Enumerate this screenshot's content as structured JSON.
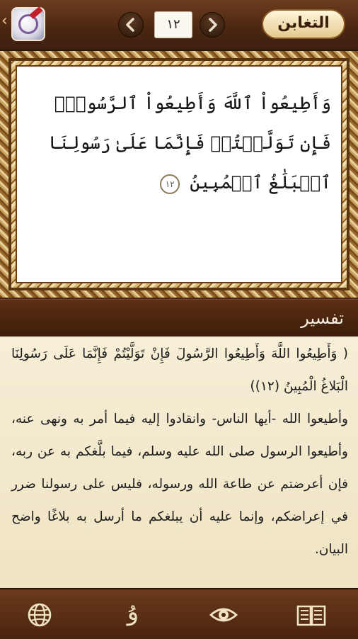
{
  "header": {
    "back_glyph": "‹",
    "logo_icon": "quran-logo-icon",
    "prev_icon": "chevron-left-icon",
    "next_icon": "chevron-right-icon",
    "page_number": "١٢",
    "surah_name": "التغابن"
  },
  "verse": {
    "text": "وَأَطِيعُواْ ٱللَّهَ وَأَطِيعُواْ ٱلرَّسُولَۚ فَإِن تَوَلَّيۡتُمۡ فَإِنَّمَا عَلَىٰ رَسُولِنَا ٱلۡبَلَٰغُ ٱلۡمُبِينُ",
    "ayah_number": "١٢"
  },
  "tafsir": {
    "title": "تفسير",
    "quote": "( وَأَطِيعُوا اللَّهَ وَأَطِيعُوا الرَّسُولَ فَإِنْ تَوَلَّيْتُمْ فَإِنَّمَا عَلَى رَسُولِنَا الْبَلاغُ الْمُبِينُ (١٢))",
    "explanation": "وأطيعوا الله -أيها الناس- وانقادوا إليه فيما أمر به ونهى عنه، وأطيعوا الرسول صلى الله عليه وسلم، فيما بلَّغكم به عن ربه، فإن أعرضتم عن طاعة الله ورسوله، فليس على رسولنا ضرر في إعراضكم، وإنما عليه أن يبلغكم ما أرسل به بلاغًا واضح البيان."
  },
  "toolbar": {
    "icons": [
      "globe-icon",
      "tajweed-icon",
      "eye-icon",
      "book-icon"
    ],
    "tajweed_glyph": "ﯗ"
  },
  "colors": {
    "bar_brown": "#4b2612",
    "parchment": "#f6eed6",
    "icon_cream": "#f0e4c4"
  }
}
